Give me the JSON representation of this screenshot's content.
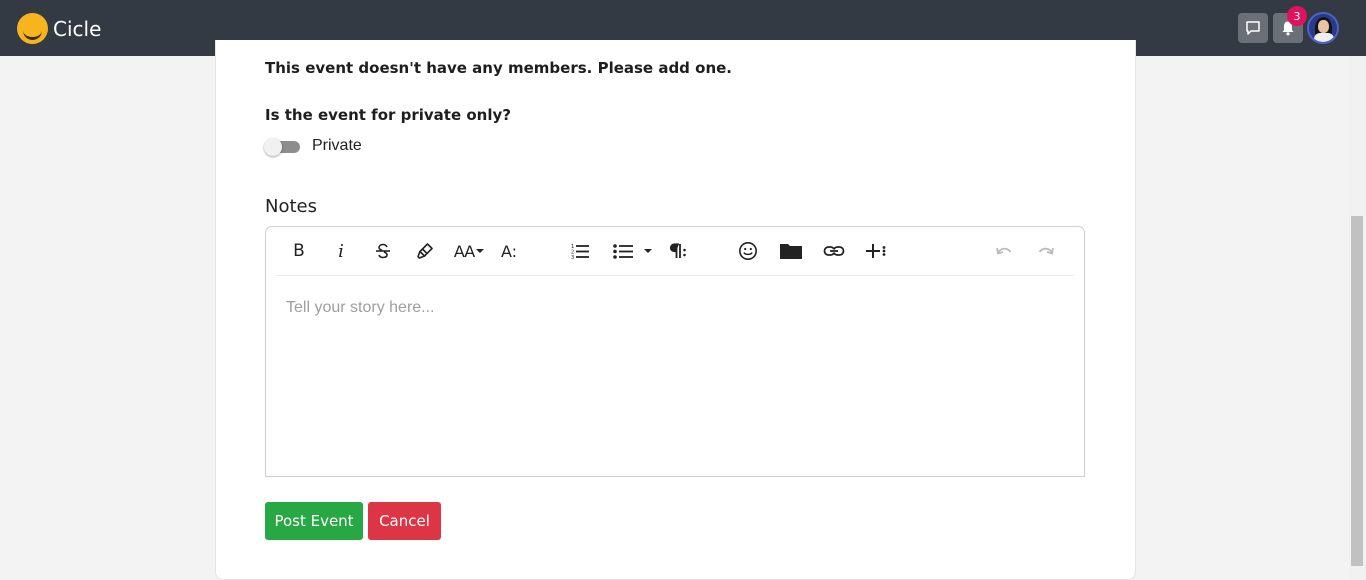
{
  "app": {
    "name": "Cicle"
  },
  "header": {
    "notification_count": "3"
  },
  "form": {
    "members_message": "This event doesn't have any members. Please add one.",
    "private_question": "Is the event for private only?",
    "private_toggle_label": "Private",
    "private_toggle_on": false,
    "notes_label": "Notes",
    "notes_placeholder": "Tell your story here...",
    "post_button": "Post Event",
    "cancel_button": "Cancel"
  },
  "toolbar": {
    "bold": "B",
    "italic": "i",
    "font_size": "AA",
    "text_style": "A:"
  },
  "colors": {
    "topbar": "#343a44",
    "post": "#28a745",
    "cancel": "#dc3545",
    "badge": "#e0115f",
    "logo": "#f6b51e"
  }
}
